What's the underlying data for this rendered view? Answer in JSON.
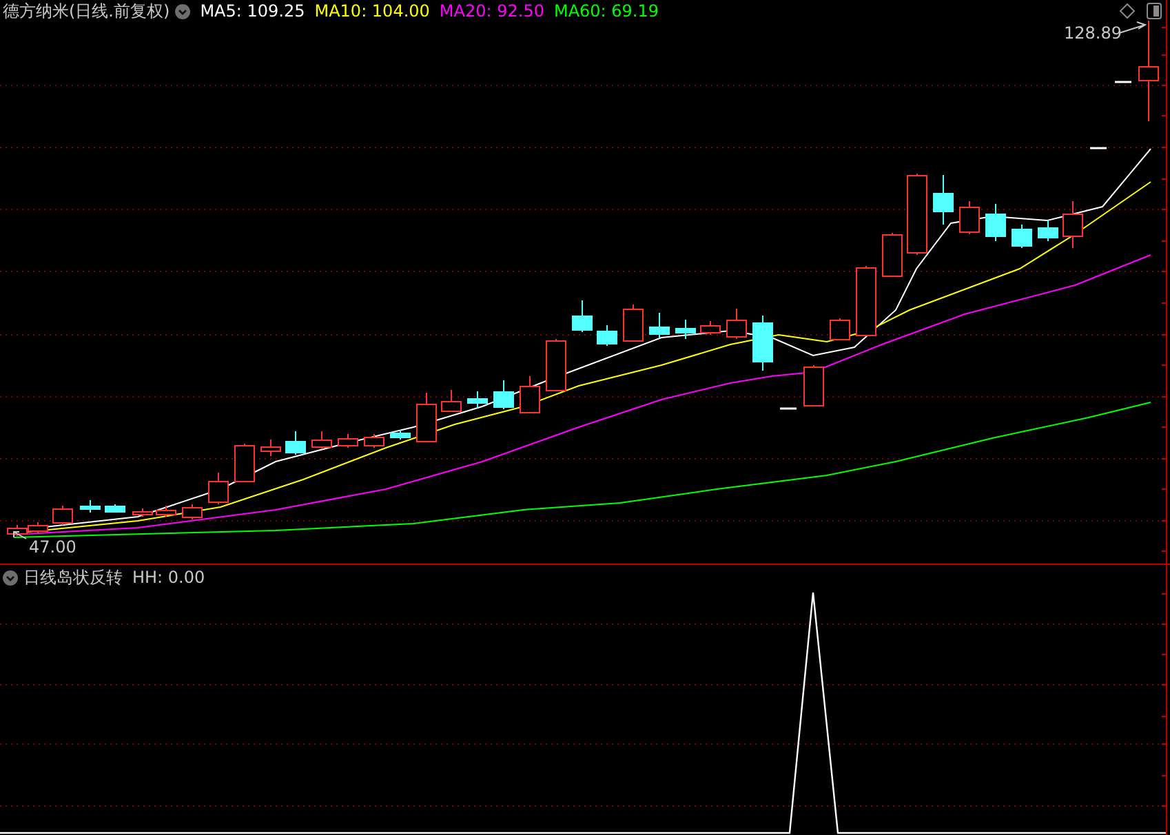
{
  "main_panel": {
    "title": "德方纳米(日线.前复权)",
    "moving_averages": [
      {
        "label": "MA5: 109.25",
        "color": "#ffffff"
      },
      {
        "label": "MA10: 104.00",
        "color": "#ffff00"
      },
      {
        "label": "MA20: 92.50",
        "color": "#ff00ff"
      },
      {
        "label": "MA60: 69.19",
        "color": "#00ff00"
      }
    ],
    "high_label": "128.89",
    "low_label": "47.00"
  },
  "indicator_panel": {
    "title": "日线岛状反转",
    "reading": "HH: 0.00"
  }
}
